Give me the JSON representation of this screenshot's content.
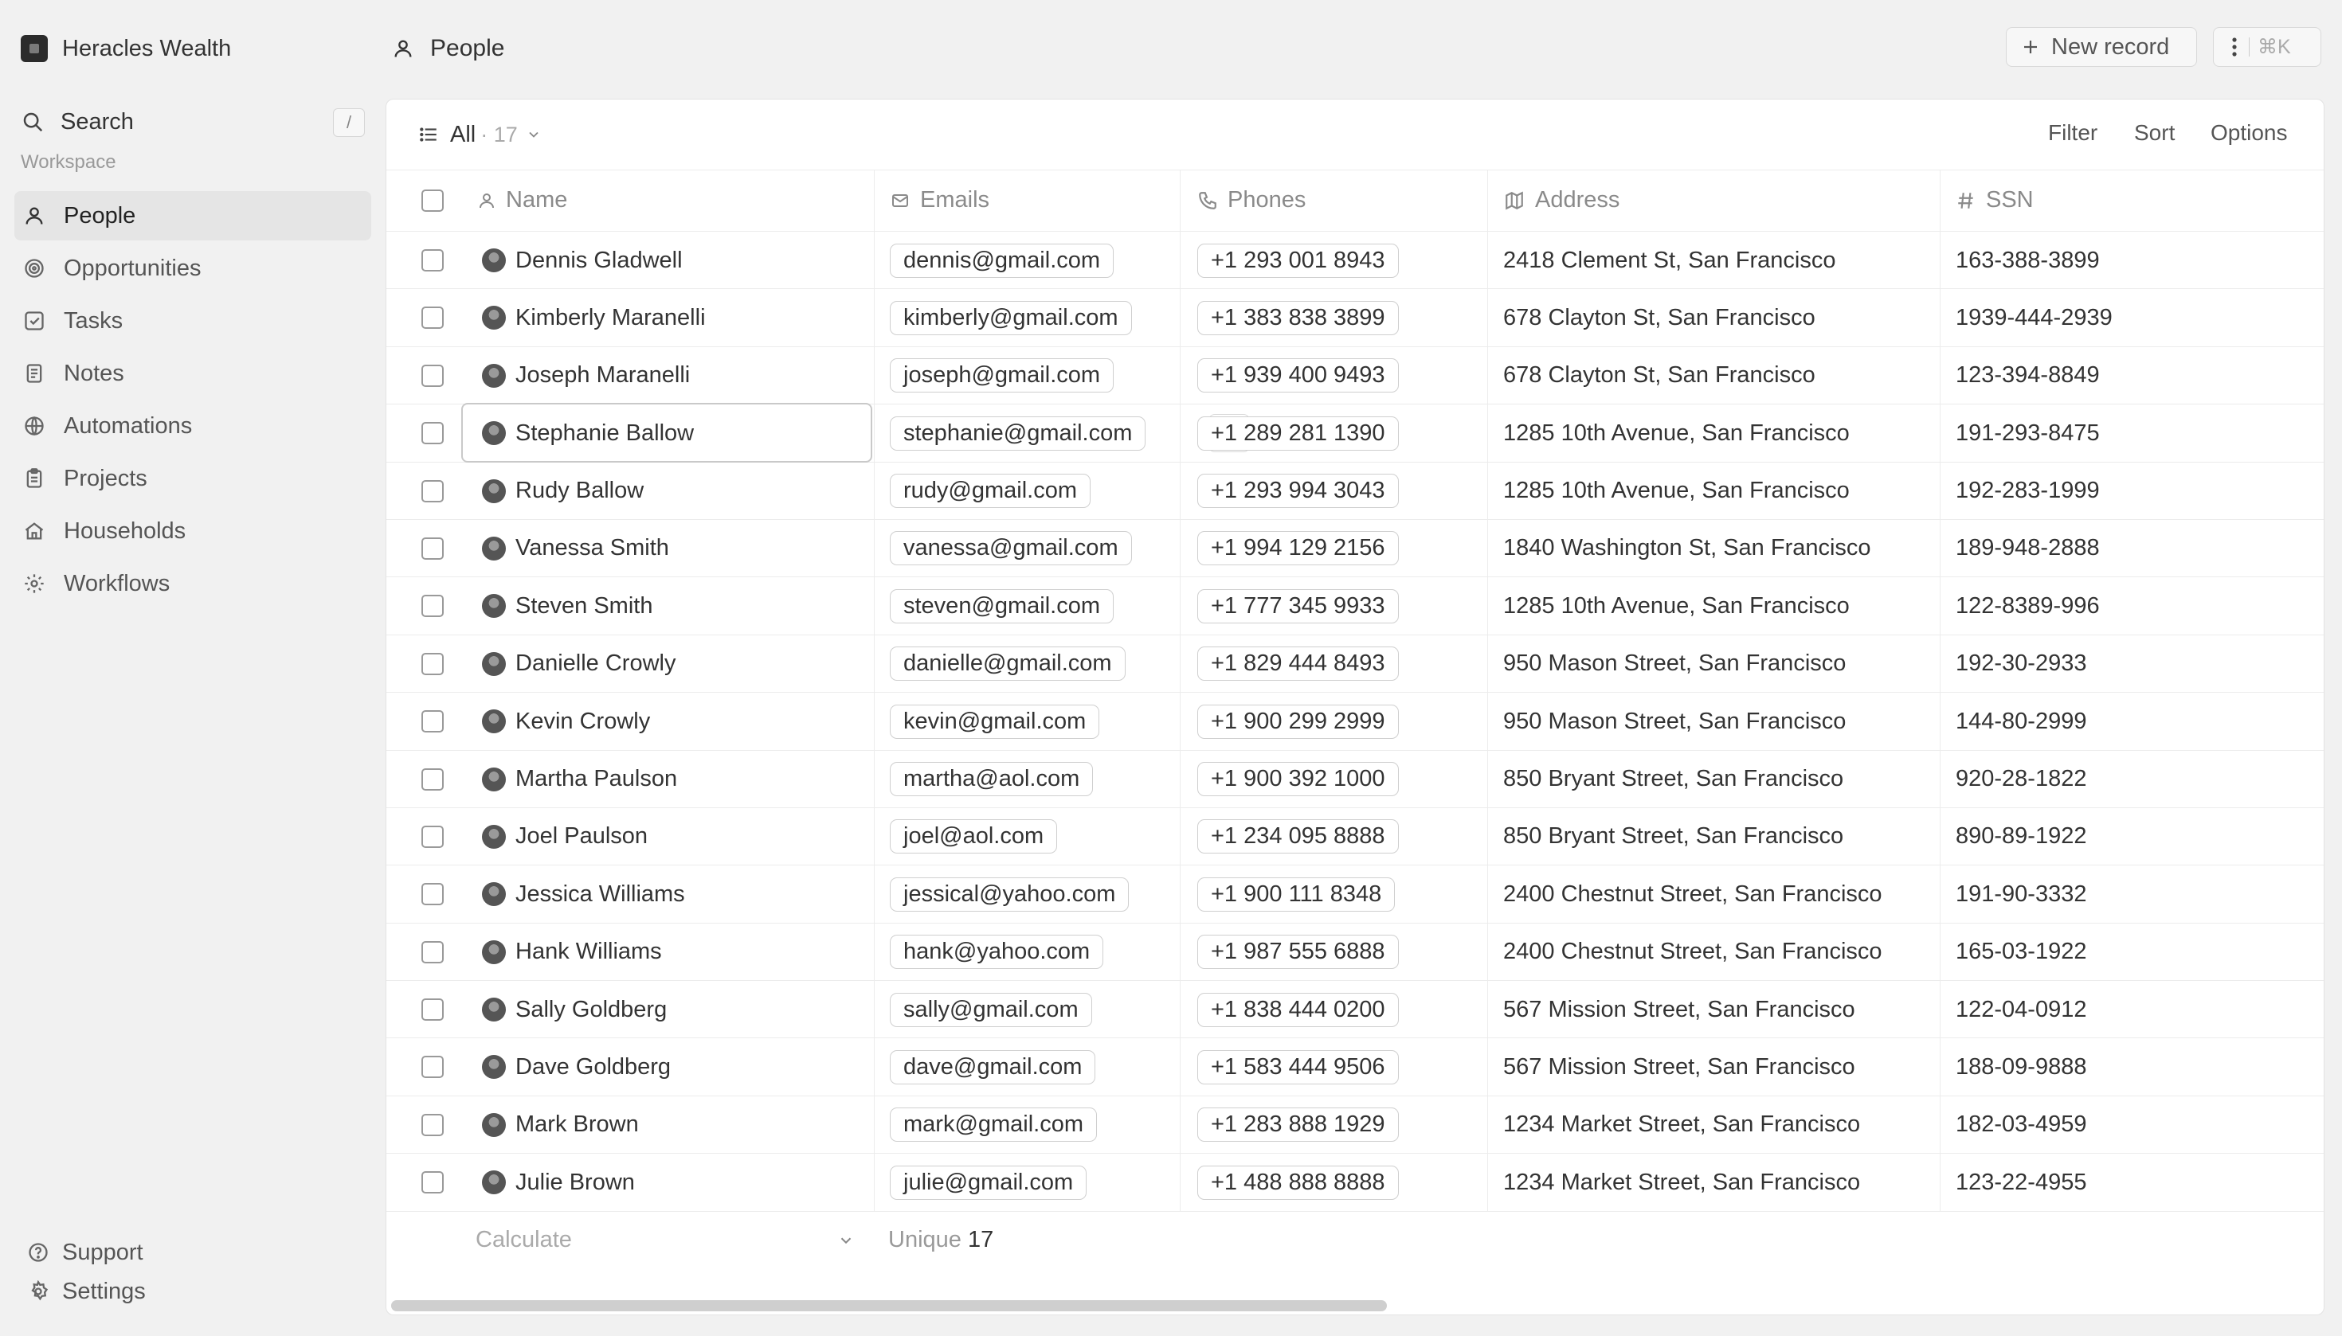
{
  "workspace": {
    "name": "Heracles Wealth"
  },
  "sidebar": {
    "search_label": "Search",
    "search_shortcut": "/",
    "section_label": "Workspace",
    "items": [
      {
        "label": "People",
        "icon": "user-icon",
        "active": true
      },
      {
        "label": "Opportunities",
        "icon": "target-icon"
      },
      {
        "label": "Tasks",
        "icon": "checkbox-icon"
      },
      {
        "label": "Notes",
        "icon": "notes-icon"
      },
      {
        "label": "Automations",
        "icon": "globe-icon"
      },
      {
        "label": "Projects",
        "icon": "clipboard-icon"
      },
      {
        "label": "Households",
        "icon": "home-icon"
      },
      {
        "label": "Workflows",
        "icon": "gear-icon"
      }
    ],
    "footer": [
      {
        "label": "Support",
        "icon": "help-icon"
      },
      {
        "label": "Settings",
        "icon": "settings-icon"
      }
    ]
  },
  "header": {
    "title": "People",
    "new_record_label": "New record",
    "shortcut_label": "⌘K"
  },
  "view": {
    "name": "All",
    "count": "· 17",
    "filter_label": "Filter",
    "sort_label": "Sort",
    "options_label": "Options"
  },
  "table": {
    "columns": [
      "Name",
      "Emails",
      "Phones",
      "Address",
      "SSN"
    ],
    "rows": [
      {
        "name": "Dennis Gladwell",
        "email": "dennis@gmail.com",
        "phone": "+1 293 001 8943",
        "address": "2418 Clement St, San Francisco",
        "ssn": "163-388-3899"
      },
      {
        "name": "Kimberly Maranelli",
        "email": "kimberly@gmail.com",
        "phone": "+1 383 838 3899",
        "address": "678 Clayton St, San Francisco",
        "ssn": "1939-444-2939"
      },
      {
        "name": "Joseph Maranelli",
        "email": "joseph@gmail.com",
        "phone": "+1 939 400 9493",
        "address": "678 Clayton St, San Francisco",
        "ssn": "123-394-8849"
      },
      {
        "name": "Stephanie Ballow",
        "email": "stephanie@gmail.com",
        "phone": "+1 289 281 1390",
        "address": "1285 10th Avenue, San Francisco",
        "ssn": "191-293-8475",
        "selected": true
      },
      {
        "name": "Rudy Ballow",
        "email": "rudy@gmail.com",
        "phone": "+1 293 994 3043",
        "address": "1285 10th Avenue, San Francisco",
        "ssn": "192-283-1999"
      },
      {
        "name": "Vanessa Smith",
        "email": "vanessa@gmail.com",
        "phone": "+1 994 129 2156",
        "address": "1840 Washington St, San Francisco",
        "ssn": "189-948-2888"
      },
      {
        "name": "Steven Smith",
        "email": "steven@gmail.com",
        "phone": "+1 777 345 9933",
        "address": "1285 10th Avenue, San Francisco",
        "ssn": "122-8389-996"
      },
      {
        "name": "Danielle Crowly",
        "email": "danielle@gmail.com",
        "phone": "+1 829 444 8493",
        "address": "950 Mason Street, San Francisco",
        "ssn": "192-30-2933"
      },
      {
        "name": "Kevin Crowly",
        "email": "kevin@gmail.com",
        "phone": "+1 900 299 2999",
        "address": "950 Mason Street, San Francisco",
        "ssn": "144-80-2999"
      },
      {
        "name": "Martha Paulson",
        "email": "martha@aol.com",
        "phone": "+1 900 392 1000",
        "address": "850 Bryant Street, San Francisco",
        "ssn": "920-28-1822"
      },
      {
        "name": "Joel Paulson",
        "email": "joel@aol.com",
        "phone": "+1 234 095 8888",
        "address": "850 Bryant Street, San Francisco",
        "ssn": "890-89-1922"
      },
      {
        "name": "Jessica Williams",
        "email": "jessical@yahoo.com",
        "phone": "+1 900 111 8348",
        "address": "2400 Chestnut Street, San Francisco",
        "ssn": "191-90-3332"
      },
      {
        "name": "Hank Williams",
        "email": "hank@yahoo.com",
        "phone": "+1 987 555 6888",
        "address": "2400 Chestnut Street, San Francisco",
        "ssn": "165-03-1922"
      },
      {
        "name": "Sally Goldberg",
        "email": "sally@gmail.com",
        "phone": "+1 838 444 0200",
        "address": "567 Mission Street, San Francisco",
        "ssn": "122-04-0912"
      },
      {
        "name": "Dave Goldberg",
        "email": "dave@gmail.com",
        "phone": "+1 583 444 9506",
        "address": "567 Mission Street, San Francisco",
        "ssn": "188-09-9888"
      },
      {
        "name": "Mark Brown",
        "email": "mark@gmail.com",
        "phone": "+1 283 888 1929",
        "address": "1234 Market Street, San Francisco",
        "ssn": "182-03-4959"
      },
      {
        "name": "Julie Brown",
        "email": "julie@gmail.com",
        "phone": "+1 488 888 8888",
        "address": "1234 Market Street, San Francisco",
        "ssn": "123-22-4955"
      }
    ],
    "footer": {
      "calculate_label": "Calculate",
      "unique_label": "Unique",
      "unique_value": "17"
    }
  }
}
